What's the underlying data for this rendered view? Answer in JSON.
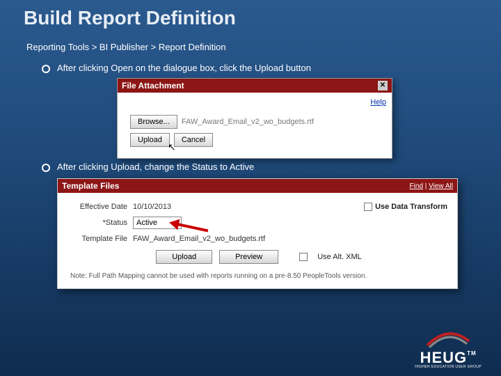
{
  "title": "Build Report Definition",
  "breadcrumb": "Reporting Tools > BI Publisher > Report Definition",
  "bullet1": "After clicking Open on the dialogue box, click the Upload button",
  "bullet2": "After clicking Upload, change the Status to Active",
  "panel1": {
    "title": "File Attachment",
    "close": "✕",
    "help": "Help",
    "browse": "Browse...",
    "filename": "FAW_Award_Email_v2_wo_budgets.rtf",
    "upload": "Upload",
    "cancel": "Cancel"
  },
  "panel2": {
    "title": "Template Files",
    "find": "Find",
    "viewall": "View All",
    "effdate_label": "Effective Date",
    "effdate_value": "10/10/2013",
    "status_label": "*Status",
    "status_value": "Active",
    "use_data_transform": "Use Data Transform",
    "template_label": "Template File",
    "template_value": "FAW_Award_Email_v2_wo_budgets.rtf",
    "upload": "Upload",
    "preview": "Preview",
    "use_alt_xml": "Use Alt. XML",
    "note": "Note: Full Path Mapping cannot be used with reports running on a pre-8.50 PeopleTools version."
  },
  "logo": {
    "text": "HEUG",
    "sub": "HIGHER EDUCATION USER GROUP",
    "tm": "TM"
  }
}
